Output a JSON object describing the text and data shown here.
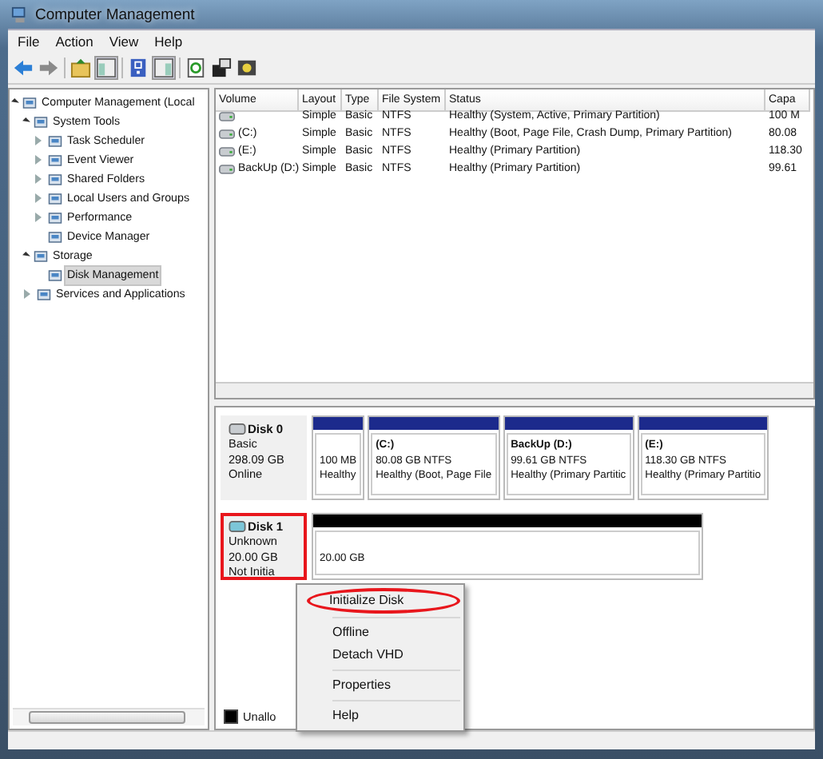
{
  "window": {
    "title": "Computer Management"
  },
  "menu": [
    "File",
    "Action",
    "View",
    "Help"
  ],
  "tree": [
    {
      "label": "Computer Management (Local",
      "expanded": true,
      "selected": false,
      "children": [
        {
          "label": "System Tools",
          "expanded": true,
          "selected": false,
          "children": [
            {
              "label": "Task Scheduler",
              "expanded": false,
              "selected": false
            },
            {
              "label": "Event Viewer",
              "expanded": false,
              "selected": false
            },
            {
              "label": "Shared Folders",
              "expanded": false,
              "selected": false
            },
            {
              "label": "Local Users and Groups",
              "expanded": false,
              "selected": false
            },
            {
              "label": "Performance",
              "expanded": false,
              "selected": false
            },
            {
              "label": "Device Manager",
              "selected": false
            }
          ]
        },
        {
          "label": "Storage",
          "expanded": true,
          "selected": false,
          "children": [
            {
              "label": "Disk Management",
              "selected": true
            }
          ]
        },
        {
          "label": "Services and Applications",
          "expanded": false,
          "selected": false
        }
      ]
    }
  ],
  "volumes": {
    "columns": [
      "Volume",
      "Layout",
      "Type",
      "File System",
      "Status",
      "Capa"
    ],
    "rows": [
      [
        "",
        "Simple",
        "Basic",
        "NTFS",
        "Healthy (System, Active, Primary Partition)",
        "100 M"
      ],
      [
        "(C:)",
        "Simple",
        "Basic",
        "NTFS",
        "Healthy (Boot, Page File, Crash Dump, Primary Partition)",
        "80.08"
      ],
      [
        "(E:)",
        "Simple",
        "Basic",
        "NTFS",
        "Healthy (Primary Partition)",
        "118.30"
      ],
      [
        "BackUp (D:)",
        "Simple",
        "Basic",
        "NTFS",
        "Healthy (Primary Partition)",
        "99.61"
      ]
    ]
  },
  "disks": [
    {
      "name": "Disk 0",
      "info": [
        "Basic",
        "298.09 GB",
        "Online"
      ],
      "highlighted": false,
      "partitions": [
        {
          "kind": "primary",
          "size": "100 MB",
          "status": "Healthy"
        },
        {
          "kind": "primary",
          "name": "(C:)",
          "size": "80.08 GB NTFS",
          "status": "Healthy (Boot, Page File"
        },
        {
          "kind": "primary",
          "name": "BackUp  (D:)",
          "size": "99.61 GB NTFS",
          "status": "Healthy (Primary Partitic"
        },
        {
          "kind": "primary",
          "name": "(E:)",
          "size": "118.30 GB NTFS",
          "status": "Healthy (Primary Partitio"
        }
      ]
    },
    {
      "name": "Disk 1",
      "info": [
        "Unknown",
        "20.00 GB",
        "Not Initia"
      ],
      "highlighted": true,
      "partitions": [
        {
          "kind": "unallocated",
          "size": "20.00 GB"
        }
      ]
    }
  ],
  "legend": [
    {
      "kind": "unallocated",
      "label": "Unallo"
    }
  ],
  "context_menu": [
    {
      "label": "Initialize Disk",
      "separator_before": false,
      "circled": true
    },
    {
      "label": "Offline",
      "separator_before": true,
      "circled": false
    },
    {
      "label": "Detach VHD",
      "separator_before": false,
      "circled": false
    },
    {
      "label": "Properties",
      "separator_before": true,
      "circled": false
    },
    {
      "label": "Help",
      "separator_before": true,
      "circled": false
    }
  ]
}
